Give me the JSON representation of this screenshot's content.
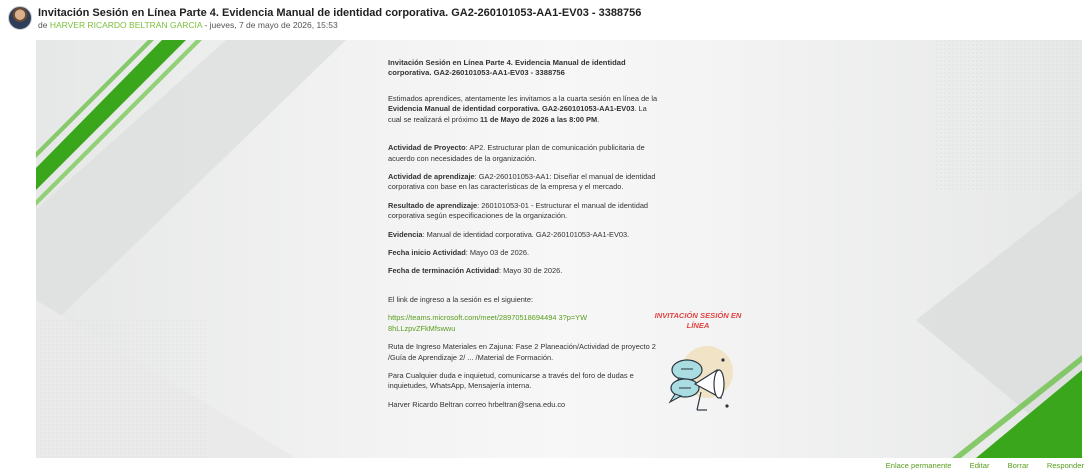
{
  "post": {
    "title": "Invitación Sesión en Línea Parte 4. Evidencia Manual de identidad corporativa. GA2-260101053-AA1-EV03 - 3388756",
    "by_prefix": "de",
    "author": "HARVER RICARDO BELTRAN GARCIA",
    "date": "- jueves, 7 de mayo de 2026, 15:53"
  },
  "content": {
    "title": "Invitación Sesión en Línea Parte 4. Evidencia Manual de identidad corporativa. GA2-260101053-AA1-EV03 - 3388756",
    "intro_1": "Estimados aprendices, atentamente les invitamos a la  cuarta sesión en línea de la ",
    "intro_bold": "Evidencia Manual de identidad corporativa. GA2-260101053-AA1-EV03",
    "intro_2": ". La cual se realizará el próximo  ",
    "intro_date": "11 de Mayo de 2026 a las 8:00 PM",
    "intro_end": ".",
    "items": [
      {
        "label": "Actividad de Proyecto",
        "text": ":  AP2. Estructurar plan de comunicación publicitaria de acuerdo con necesidades de la organización."
      },
      {
        "label": "Actividad de aprendizaje",
        "text": ": GA2-260101053-AA1: Diseñar el manual de identidad corporativa con base en las características de la empresa y el mercado."
      },
      {
        "label": "Resultado de aprendizaje",
        "text": ": 260101053-01 - Estructurar el manual de identidad corporativa según especificaciones de la organización."
      },
      {
        "label": "Evidencia",
        "text": ": Manual de identidad corporativa. GA2-260101053-AA1-EV03."
      },
      {
        "label": "Fecha inicio Actividad",
        "text": ":  Mayo 03 de 2026."
      },
      {
        "label": "Fecha de terminación Actividad",
        "text": ": Mayo 30 de 2026."
      }
    ],
    "link_intro": "El link de ingreso a la sesión es el siguiente:",
    "link": "https://teams.microsoft.com/meet/28970518694494 3?p=YW8hLLzpvZFkMfswwu",
    "route": "Ruta de Ingreso Materiales en Zajuna:  Fase 2 Planeación/Actividad de proyecto 2 /Guía de Aprendizaje 2/ ... /Material de Formación.",
    "doubts": "Para Cualquier duda e inquietud, comunicarse a través del foro de dudas e inquietudes, WhatsApp, Mensajería interna.",
    "signature": "Harver Ricardo Beltran correo hrbeltran@sena.edu.co"
  },
  "invite_label": "INVITACIÓN SESIÓN EN LÍNEA",
  "footer": {
    "permalink": "Enlace permanente",
    "edit": "Editar",
    "delete": "Borrar",
    "reply": "Responder"
  },
  "colors": {
    "accent_green": "#5a9e1f",
    "invite_red": "#e04646",
    "stripe_green": "#3aa61b"
  }
}
